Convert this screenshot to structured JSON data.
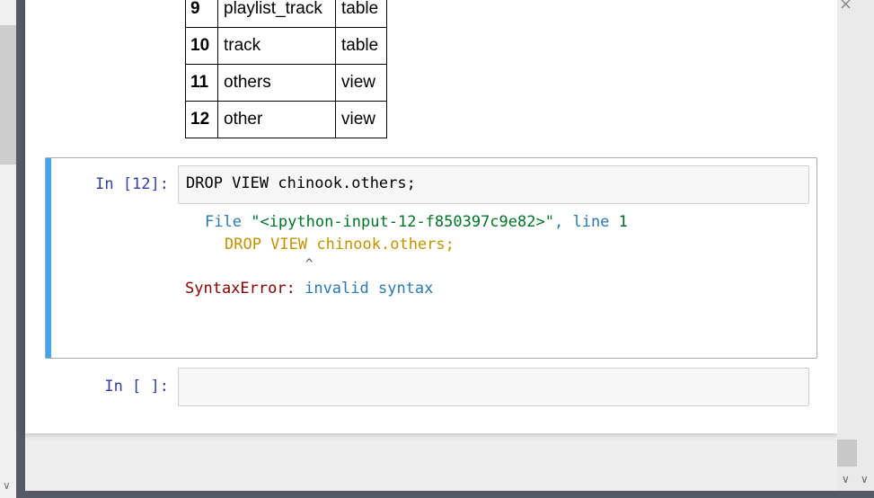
{
  "table": {
    "rows": [
      {
        "index": "9",
        "name": "playlist_track",
        "type": "table"
      },
      {
        "index": "10",
        "name": "track",
        "type": "table"
      },
      {
        "index": "11",
        "name": "others",
        "type": "view"
      },
      {
        "index": "12",
        "name": "other",
        "type": "view"
      }
    ]
  },
  "cell12": {
    "prompt": "In [12]:",
    "code": "DROP VIEW chinook.others;",
    "error": {
      "file_label": "File",
      "file_name": "\"<ipython-input-12-f850397c9e82>\"",
      "comma": ",",
      "line_label": "line",
      "line_number": "1",
      "code_line": "DROP VIEW chinook.others;",
      "caret": "^",
      "error_type": "SyntaxError",
      "colon": ":",
      "error_message": "invalid syntax"
    }
  },
  "cell_empty": {
    "prompt": "In [ ]:",
    "code": ""
  },
  "icons": {
    "close": "×",
    "chevron_down": "∨"
  },
  "colors": {
    "prompt": "#303f9f",
    "selected_bar": "#42a5f5",
    "error_name": "#8b0000",
    "file_name": "#007427",
    "highlighted_code": "#c39200"
  }
}
